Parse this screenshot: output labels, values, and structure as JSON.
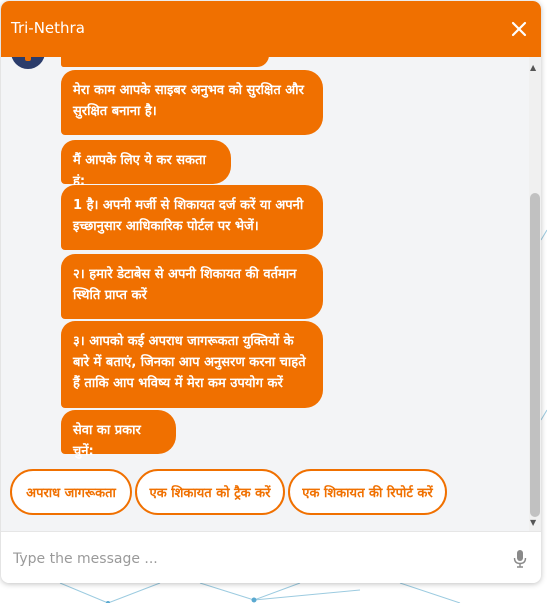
{
  "header": {
    "title": "Tri-Nethra"
  },
  "icons": {
    "close": "close-icon",
    "mic": "mic-icon",
    "avatar": "bot-avatar-icon"
  },
  "colors": {
    "accent": "#f07000",
    "panel": "#f3f4f6",
    "text_on_accent": "#ffffff"
  },
  "messages": [
    {
      "text": "मेरा काम आपके साइबर अनुभव को सुरक्षित और सुरक्षित बनाना है।"
    },
    {
      "text": "मैं आपके लिए ये कर सकता हूं:"
    },
    {
      "text": "1 है। अपनी मर्जी से शिकायत दर्ज करें या अपनी इच्छानुसार आधिकारिक पोर्टल पर भेजें।"
    },
    {
      "text": "२। हमारे डेटाबेस से अपनी शिकायत की वर्तमान स्थिति प्राप्त करें"
    },
    {
      "text": "३। आपको कई अपराध जागरूकता युक्तियों के बारे में बताएं, जिनका आप अनुसरण करना चाहते हैं ताकि आप भविष्य में मेरा कम उपयोग करें"
    },
    {
      "text": "सेवा का प्रकार चुनें:"
    }
  ],
  "quick_replies": [
    {
      "label": "अपराध जागरूकता"
    },
    {
      "label": "एक शिकायत को ट्रैक करें"
    },
    {
      "label": "एक शिकायत की रिपोर्ट करें"
    }
  ],
  "composer": {
    "placeholder": "Type the message ..."
  }
}
